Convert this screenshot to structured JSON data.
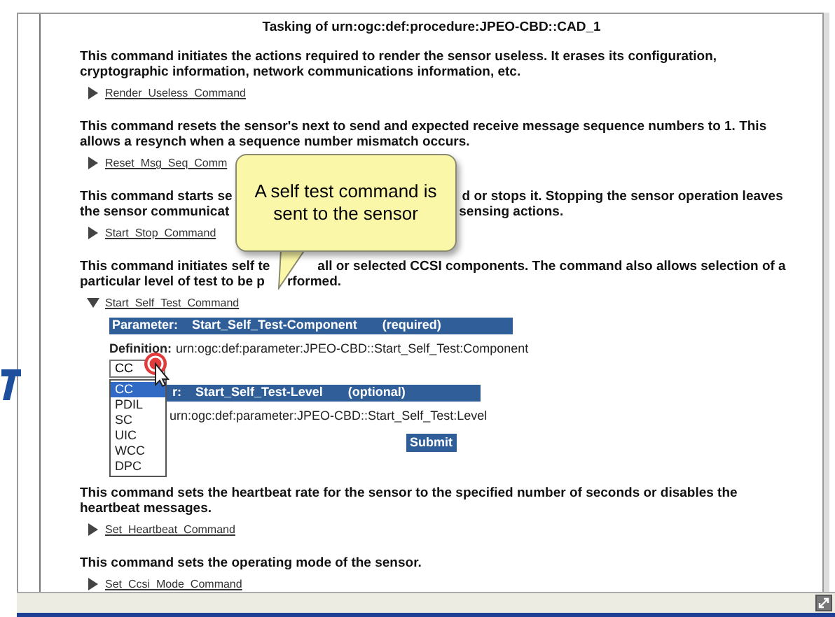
{
  "window": {
    "title": "Tasking of urn:ogc:def:procedure:JPEO-CBD::CAD_1"
  },
  "callout": {
    "text": "A self test command is sent to the sensor"
  },
  "commands": [
    {
      "kind": "plain",
      "lines": [
        {
          "parts": [
            "This command initiates the actions required to render the sensor useless. It erases its configuration,"
          ]
        },
        {
          "parts": [
            "cryptographic information, network communications information, etc."
          ]
        }
      ],
      "link": "Render_Useless_Command",
      "expanded": false
    },
    {
      "kind": "plain",
      "lines": [
        {
          "parts": [
            "This command resets the sensor's next to send and expected receive message sequence numbers to 1. This"
          ]
        },
        {
          "parts": [
            "allows a resynch when a sequence number mismatch occurs."
          ]
        }
      ],
      "link": "Reset_Msg_Seq_Comm",
      "expanded": false
    },
    {
      "kind": "callout",
      "lines": [
        {
          "parts": [
            "This command starts se",
            "d or stops it. Stopping the sensor operation leaves"
          ]
        },
        {
          "parts": [
            "the sensor communicat",
            "sensing actions."
          ]
        }
      ],
      "link": "Start_Stop_Command",
      "expanded": false
    },
    {
      "kind": "pointer",
      "lines": [
        {
          "parts": [
            "This command initiates self te",
            "all or selected CCSI components. The command also allows selection of a"
          ]
        },
        {
          "parts": [
            "particular level of test to be p",
            "rformed."
          ]
        }
      ],
      "link": "Start_Self_Test_Command",
      "expanded": true,
      "form": {
        "params": [
          {
            "label": "Parameter:",
            "name": "Start_Self_Test-Component",
            "note": "(required)",
            "definition_label": "Definition:",
            "definition": "urn:ogc:def:parameter:JPEO-CBD::Start_Self_Test:Component"
          },
          {
            "label": "r:",
            "name": "Start_Self_Test-Level",
            "note": "(optional)",
            "definition": "urn:ogc:def:parameter:JPEO-CBD::Start_Self_Test:Level"
          }
        ],
        "dropdown": {
          "value": "CC",
          "expanded": true,
          "options": [
            {
              "label": "CC",
              "selected": true
            },
            {
              "label": "PDIL",
              "selected": false
            },
            {
              "label": "SC",
              "selected": false
            },
            {
              "label": "UIC",
              "selected": false
            },
            {
              "label": "WCC",
              "selected": false
            },
            {
              "label": "DPC",
              "selected": false
            }
          ]
        },
        "submit": "Submit"
      }
    },
    {
      "kind": "plain",
      "lines": [
        {
          "parts": [
            "This command sets the heartbeat rate for the sensor to the specified number of seconds or disables the"
          ]
        },
        {
          "parts": [
            "heartbeat messages."
          ]
        }
      ],
      "link": "Set_Heartbeat_Command",
      "expanded": false
    },
    {
      "kind": "plain",
      "lines": [
        {
          "parts": [
            "This command sets the operating mode of the sensor."
          ]
        }
      ],
      "link": "Set_Ccsi_Mode_Command",
      "expanded": false
    }
  ]
}
